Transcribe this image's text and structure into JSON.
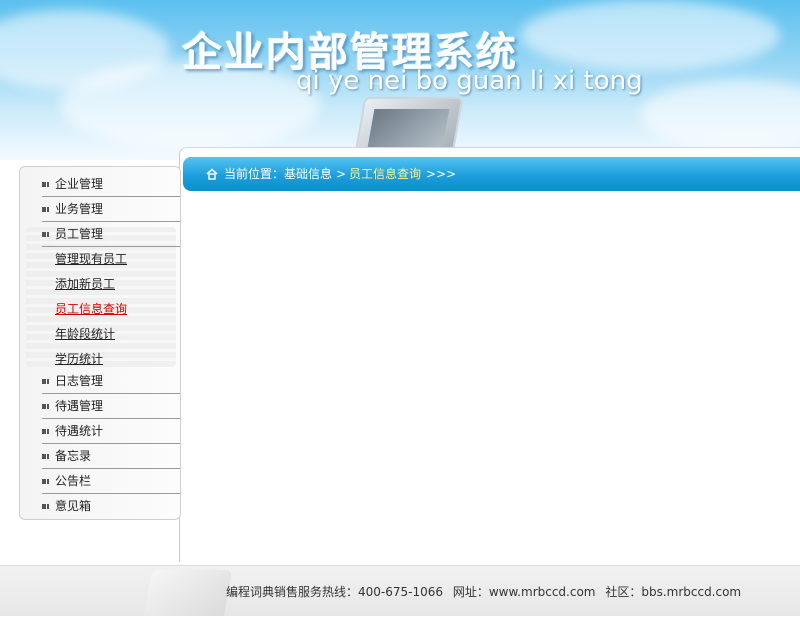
{
  "header": {
    "title": "企业内部管理系统",
    "subtitle": "qi ye nei bo guan li xi tong"
  },
  "breadcrumb": {
    "home_icon": "home-icon",
    "prefix": "当前位置：基础信息",
    "separator": ">",
    "current": "员工信息查询",
    "trail": ">>>"
  },
  "sidebar": {
    "items": [
      {
        "label": "企业管理"
      },
      {
        "label": "业务管理"
      },
      {
        "label": "员工管理"
      },
      {
        "label": "日志管理"
      },
      {
        "label": "待遇管理"
      },
      {
        "label": "待遇统计"
      },
      {
        "label": "备忘录"
      },
      {
        "label": "公告栏"
      },
      {
        "label": "意见箱"
      }
    ],
    "sub_items": [
      {
        "label": "管理现有员工"
      },
      {
        "label": "添加新员工"
      },
      {
        "label": "员工信息查询",
        "active": true
      },
      {
        "label": "年龄段统计"
      },
      {
        "label": "学历统计"
      }
    ]
  },
  "footer": {
    "hotline": "编程词典销售服务热线：400-675-1066",
    "website": "网址：www.mrbccd.com",
    "community": "社区：bbs.mrbccd.com"
  },
  "colors": {
    "accent": "#1c9fdc",
    "active_link": "#d10000",
    "breadcrumb_current": "#fff48a"
  }
}
